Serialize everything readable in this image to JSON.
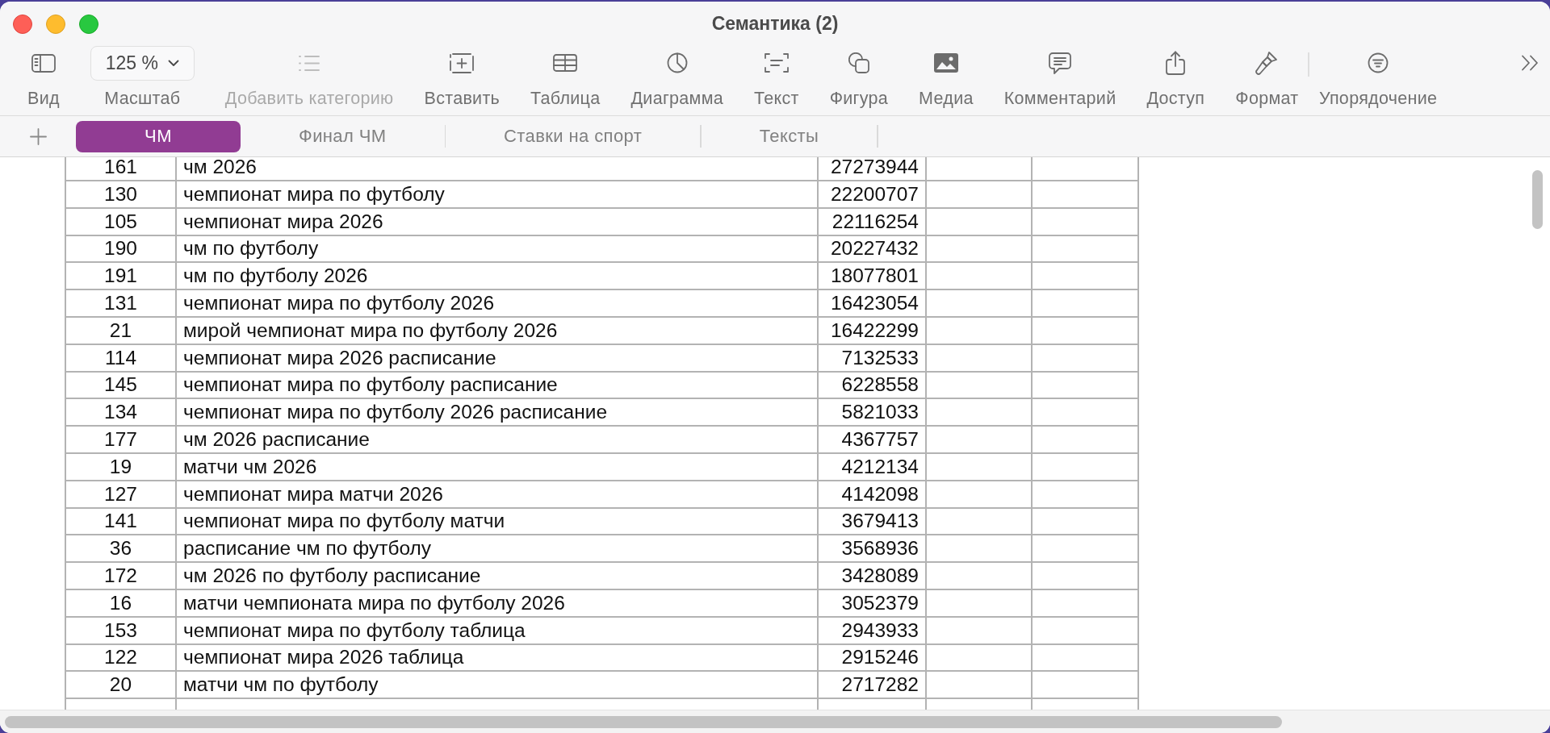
{
  "window": {
    "title": "Семантика (2)"
  },
  "toolbar": {
    "groups": [
      [
        {
          "kind": "button",
          "label": "Вид",
          "disabled": false
        },
        {
          "kind": "dropdown",
          "label": "Масштаб",
          "value": "125 %",
          "disabled": false
        },
        {
          "kind": "button",
          "label": "Добавить категорию",
          "disabled": true
        },
        {
          "kind": "button",
          "label": "Вставить",
          "disabled": false
        },
        {
          "kind": "button",
          "label": "Таблица",
          "disabled": false
        },
        {
          "kind": "button",
          "label": "Диаграмма",
          "disabled": false
        },
        {
          "kind": "button",
          "label": "Текст",
          "disabled": false
        },
        {
          "kind": "button",
          "label": "Фигура",
          "disabled": false
        },
        {
          "kind": "button",
          "label": "Медиа",
          "disabled": false
        },
        {
          "kind": "button",
          "label": "Комментарий",
          "disabled": false
        },
        {
          "kind": "button",
          "label": "Доступ",
          "disabled": false
        },
        {
          "kind": "button",
          "label": "Формат",
          "disabled": false
        }
      ],
      [
        {
          "kind": "button",
          "label": "Упорядочение",
          "disabled": false
        }
      ]
    ]
  },
  "sheet_tabs": [
    {
      "label": "ЧМ",
      "selected": true
    },
    {
      "label": "Финал ЧМ",
      "selected": false
    },
    {
      "label": "Ставки на спорт",
      "selected": false
    },
    {
      "label": "Тексты",
      "selected": false
    }
  ],
  "table": {
    "rows": [
      [
        "161",
        "чм 2026",
        "27273944"
      ],
      [
        "130",
        "чемпионат мира по футболу",
        "22200707"
      ],
      [
        "105",
        "чемпионат мира 2026",
        "22116254"
      ],
      [
        "190",
        "чм по футболу",
        "20227432"
      ],
      [
        "191",
        "чм по футболу 2026",
        "18077801"
      ],
      [
        "131",
        "чемпионат мира по футболу 2026",
        "16423054"
      ],
      [
        "21",
        "мирой чемпионат мира по футболу 2026",
        "16422299"
      ],
      [
        "114",
        "чемпионат мира 2026 расписание",
        "7132533"
      ],
      [
        "145",
        "чемпионат мира по футболу расписание",
        "6228558"
      ],
      [
        "134",
        "чемпионат мира по футболу 2026 расписание",
        "5821033"
      ],
      [
        "177",
        "чм 2026 расписание",
        "4367757"
      ],
      [
        "19",
        "матчи чм 2026",
        "4212134"
      ],
      [
        "127",
        "чемпионат мира матчи 2026",
        "4142098"
      ],
      [
        "141",
        "чемпионат мира по футболу матчи",
        "3679413"
      ],
      [
        "36",
        "расписание чм по футболу",
        "3568936"
      ],
      [
        "172",
        "чм 2026 по футболу расписание",
        "3428089"
      ],
      [
        "16",
        "матчи чемпионата мира по футболу 2026",
        "3052379"
      ],
      [
        "153",
        "чемпионат мира по футболу таблица",
        "2943933"
      ],
      [
        "122",
        "чемпионат мира 2026 таблица",
        "2915246"
      ],
      [
        "20",
        "матчи чм по футболу",
        "2717282"
      ]
    ]
  }
}
